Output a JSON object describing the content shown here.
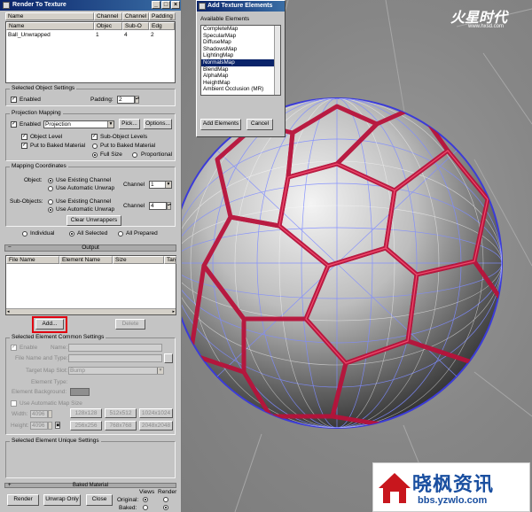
{
  "render_to_texture": {
    "title": "Render To Texture",
    "objects_table": {
      "columns_row1": [
        "Name",
        "Channel",
        "Channel",
        "Padding"
      ],
      "columns_row2": [
        "Name",
        "Objec",
        "Sub-O",
        "Edg"
      ],
      "rows": [
        {
          "name": "Ball_Unwrapped",
          "object_channel": "1",
          "sub_channel": "4",
          "padding": "2"
        }
      ]
    },
    "selected_object_settings": {
      "title": "Selected Object Settings",
      "enabled_label": "Enabled",
      "padding_label": "Padding:",
      "padding_value": "2"
    },
    "projection_mapping": {
      "title": "Projection Mapping",
      "enabled_label": "Enabled",
      "projection_value": "Projection",
      "pick_button": "Pick...",
      "options_button": "Options...",
      "object_level_label": "Object Level",
      "sub_object_levels_label": "Sub-Object Levels",
      "put_to_baked_label": "Put to Baked Material",
      "put_to_baked_label_2": "Put to Baked Material",
      "full_size_label": "Full Size",
      "proportional_label": "Proportional"
    },
    "mapping_coordinates": {
      "title": "Mapping Coordinates",
      "object_label": "Object:",
      "use_existing_channel": "Use Existing Channel",
      "use_automatic_unwrap": "Use Automatic Unwrap",
      "channel_label": "Channel",
      "object_channel_value": "1",
      "sub_objects_label": "Sub-Objects:",
      "sub_use_existing_channel": "Use Existing Channel",
      "sub_use_automatic_unwrap": "Use Automatic Unwrap",
      "sub_channel_value": "4",
      "clear_unwrappers_button": "Clear Unwrappers"
    },
    "scope": {
      "individual": "Individual",
      "all_selected": "All Selected",
      "all_prepared": "All Prepared"
    },
    "output_rollout": {
      "title": "Output",
      "columns": [
        "File Name",
        "Element Name",
        "Size",
        "Targ"
      ],
      "add_button": "Add...",
      "delete_button": "Delete"
    },
    "common_settings": {
      "title": "Selected Element Common Settings",
      "enable_label": "Enable",
      "name_label": "Name:",
      "file_name_type_label": "File Name and Type:",
      "target_map_slot_label": "Target Map Slot:",
      "target_map_slot_value": "Bump",
      "element_type_label": "Element Type:",
      "element_background_label": "Element Background:",
      "use_automatic_map_size_label": "Use Automatic Map Size",
      "width_label": "Width:",
      "width_value": "4096",
      "height_label": "Height:",
      "height_value": "4096",
      "size_presets": [
        "128x128",
        "512x512",
        "1024x1024",
        "256x256",
        "768x768",
        "2048x2048"
      ]
    },
    "unique_settings": {
      "title": "Selected Element Unique Settings"
    },
    "baked_material_rollout": {
      "title": "Baked Material"
    },
    "bottom": {
      "render_button": "Render",
      "unwrap_only_button": "Unwrap Only",
      "close_button": "Close",
      "views_label": "Views",
      "render_label": "Render",
      "original_label": "Original:",
      "baked_label": "Baked:"
    }
  },
  "add_texture_elements": {
    "title": "Add Texture Elements",
    "available_label": "Available Elements",
    "items": [
      "CompleteMap",
      "SpecularMap",
      "DiffuseMap",
      "ShadowsMap",
      "LightingMap",
      "NormalsMap",
      "BlendMap",
      "AlphaMap",
      "HeightMap",
      "Ambient Occlusion (MR)"
    ],
    "selected_index": 5,
    "add_elements_button": "Add Elements",
    "cancel_button": "Cancel"
  },
  "watermarks": {
    "top_logo": "火星时代",
    "top_url": "www.hxsd.com",
    "bottom_logo": "晓枫资讯",
    "bottom_url": "bbs.yzwlo.com"
  },
  "colors": {
    "panel_bg": "#c4c4c4",
    "titlebar": "#0a246a",
    "highlight": "#e0000f",
    "ball_seams": "#b8123a",
    "wireframe": "#5a6cff"
  }
}
